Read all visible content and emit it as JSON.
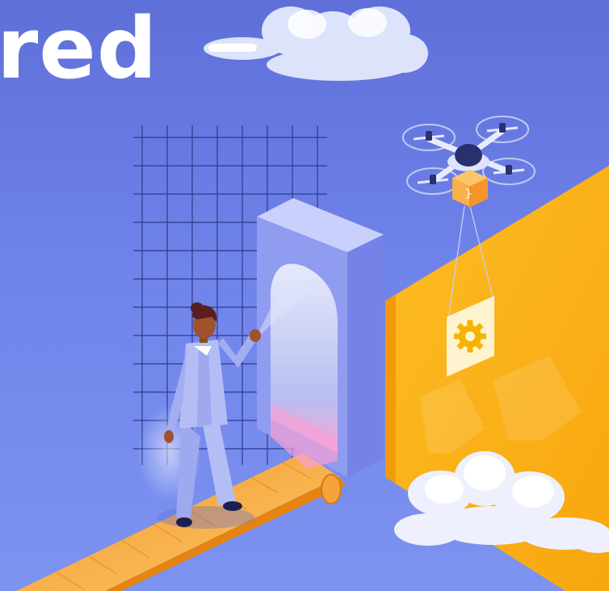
{
  "headline": {
    "text": "red"
  },
  "colors": {
    "background_top": "#5f6fd8",
    "background_bottom": "#7d93f0",
    "panel_yellow": "#fcb41a",
    "conveyor_orange": "#f8a93a",
    "arch_lavender": "#aab5f6",
    "person_suit": "#b4bef5",
    "drone_body": "#2a2f6e"
  },
  "icons": {
    "gear_card": "gear-icon",
    "package": "package-icon"
  }
}
